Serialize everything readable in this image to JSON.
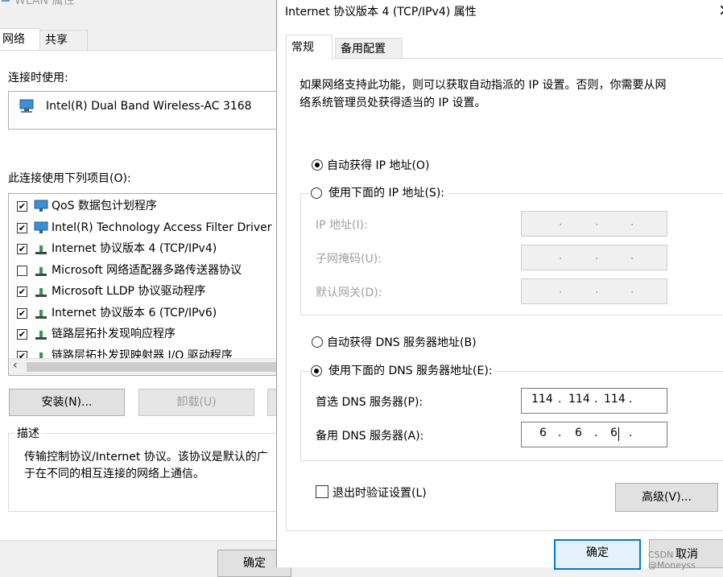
{
  "back": {
    "title": "WLAN 属性",
    "tabs": [
      "网络",
      "共享"
    ],
    "connect_using_label": "连接时使用:",
    "adapter_name": "Intel(R) Dual Band Wireless-AC 3168",
    "items_label": "此连接使用下列项目(O):",
    "items": [
      {
        "label": "QoS 数据包计划程序",
        "checked": "✔"
      },
      {
        "label": "Intel(R) Technology Access Filter Driver",
        "checked": "✔"
      },
      {
        "label": "Internet 协议版本 4 (TCP/IPv4)",
        "checked": "✔"
      },
      {
        "label": "Microsoft 网络适配器多路传送器协议",
        "checked": ""
      },
      {
        "label": "Microsoft LLDP 协议驱动程序",
        "checked": "✔"
      },
      {
        "label": "Internet 协议版本 6 (TCP/IPv6)",
        "checked": "✔"
      },
      {
        "label": "链路层拓扑发现响应程序",
        "checked": "✔"
      },
      {
        "label": "链路层拓扑发现映射器 I/O 驱动程序",
        "checked": "✔"
      }
    ],
    "install_button": "安装(N)...",
    "uninstall_button": "卸载(U)",
    "description_label": "描述",
    "description_line1": "传输控制协议/Internet 协议。该协议是默认的广",
    "description_line2": "于在不同的相互连接的网络上通信。",
    "ok_button": "确定"
  },
  "front": {
    "title": "Internet 协议版本 4 (TCP/IPv4) 属性",
    "close_glyph": "×",
    "tabs": [
      "常规",
      "备用配置"
    ],
    "intro_line1": "如果网络支持此功能，则可以获取自动指派的 IP 设置。否则，你需要从网",
    "intro_line2": "络系统管理员处获得适当的 IP 设置。",
    "auto_ip": "自动获得 IP 地址(O)",
    "manual_ip": "使用下面的 IP 地址(S):",
    "ip_label": "IP 地址(I):",
    "mask_label": "子网掩码(U):",
    "gateway_label": "默认网关(D):",
    "auto_dns": "自动获得 DNS 服务器地址(B)",
    "manual_dns": "使用下面的 DNS 服务器地址(E):",
    "preferred_dns_label": "首选 DNS 服务器(P):",
    "preferred_dns": [
      "114",
      "114",
      "114",
      ""
    ],
    "alternate_dns_label": "备用 DNS 服务器(A):",
    "alternate_dns": [
      "6",
      "6",
      "6",
      ""
    ],
    "validate_label": "退出时验证设置(L)",
    "advanced_button": "高级(V)...",
    "ok_button": "确定",
    "cancel_button": "取消",
    "dot": "."
  },
  "watermark": "CSDN @Moneyss"
}
